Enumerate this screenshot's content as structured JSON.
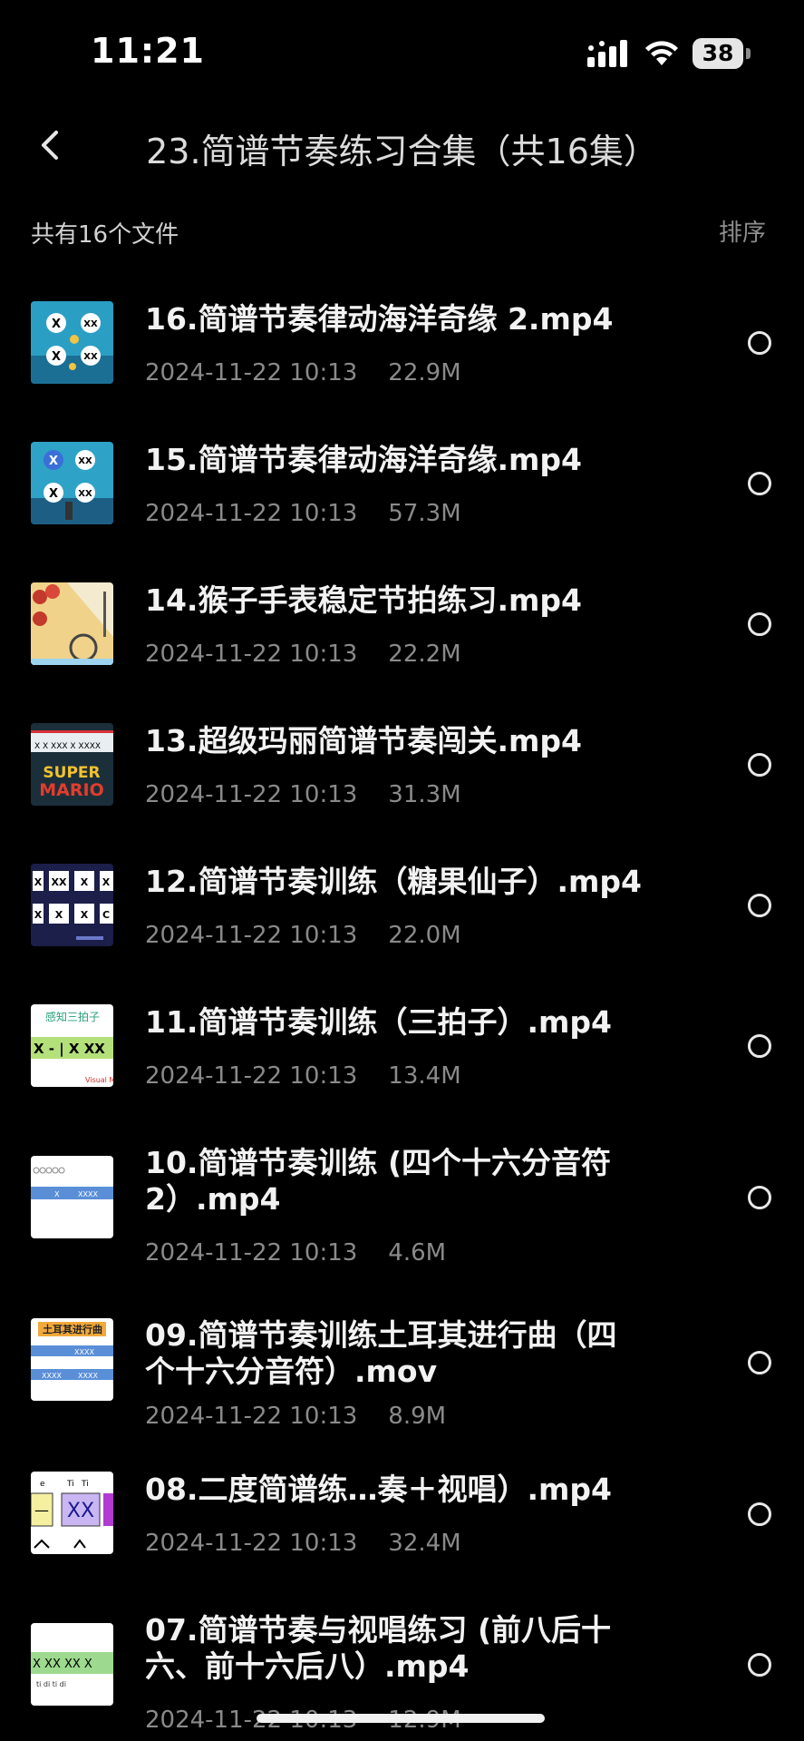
{
  "status_bar": {
    "time": "11:21",
    "battery": "38",
    "icons": [
      "signal-icon",
      "wifi-icon",
      "battery-icon"
    ]
  },
  "nav": {
    "back_icon": "chevron-left-icon",
    "title": "23.简谱节奏练习合集（共16集）"
  },
  "list_header": {
    "count_label": "共有16个文件",
    "sort_label": "排序"
  },
  "files": [
    {
      "name": "16.简谱节奏律动海洋奇缘 2.mp4",
      "date": "2024-11-22 10:13",
      "size": "22.9M"
    },
    {
      "name": "15.简谱节奏律动海洋奇缘.mp4",
      "date": "2024-11-22 10:13",
      "size": "57.3M"
    },
    {
      "name": "14.猴子手表稳定节拍练习.mp4",
      "date": "2024-11-22 10:13",
      "size": "22.2M"
    },
    {
      "name": "13.超级玛丽简谱节奏闯关.mp4",
      "date": "2024-11-22 10:13",
      "size": "31.3M"
    },
    {
      "name": "12.简谱节奏训练（糖果仙子）.mp4",
      "date": "2024-11-22 10:13",
      "size": "22.0M"
    },
    {
      "name": "11.简谱节奏训练（三拍子）.mp4",
      "date": "2024-11-22 10:13",
      "size": "13.4M"
    },
    {
      "name": "10.简谱节奏训练 (四个十六分音符 2）.mp4",
      "date": "2024-11-22 10:13",
      "size": "4.6M"
    },
    {
      "name": "09.简谱节奏训练土耳其进行曲（四个十六分音符）.mov",
      "date": "2024-11-22 10:13",
      "size": "8.9M"
    },
    {
      "name": "08.二度简谱练…奏＋视唱）.mp4",
      "date": "2024-11-22 10:13",
      "size": "32.4M"
    },
    {
      "name": "07.简谱节奏与视唱练习 (前八后十六、前十六后八）.mp4",
      "date": "2024-11-22 10:13",
      "size": "12.9M"
    }
  ],
  "thumbnail_text": {
    "t11_title": "感知三拍子",
    "t11_row": "X - | X XX",
    "t11_brand": "Visual Mu",
    "t9_title": "土耳其进行曲",
    "t13_logo_top": "SUPER",
    "t13_logo_bottom": "MARIO"
  },
  "colors": {
    "background": "#000000",
    "title_text": "#f2f2f2",
    "meta_text": "#8a8a8a",
    "sort_text": "#8e8e8e"
  }
}
